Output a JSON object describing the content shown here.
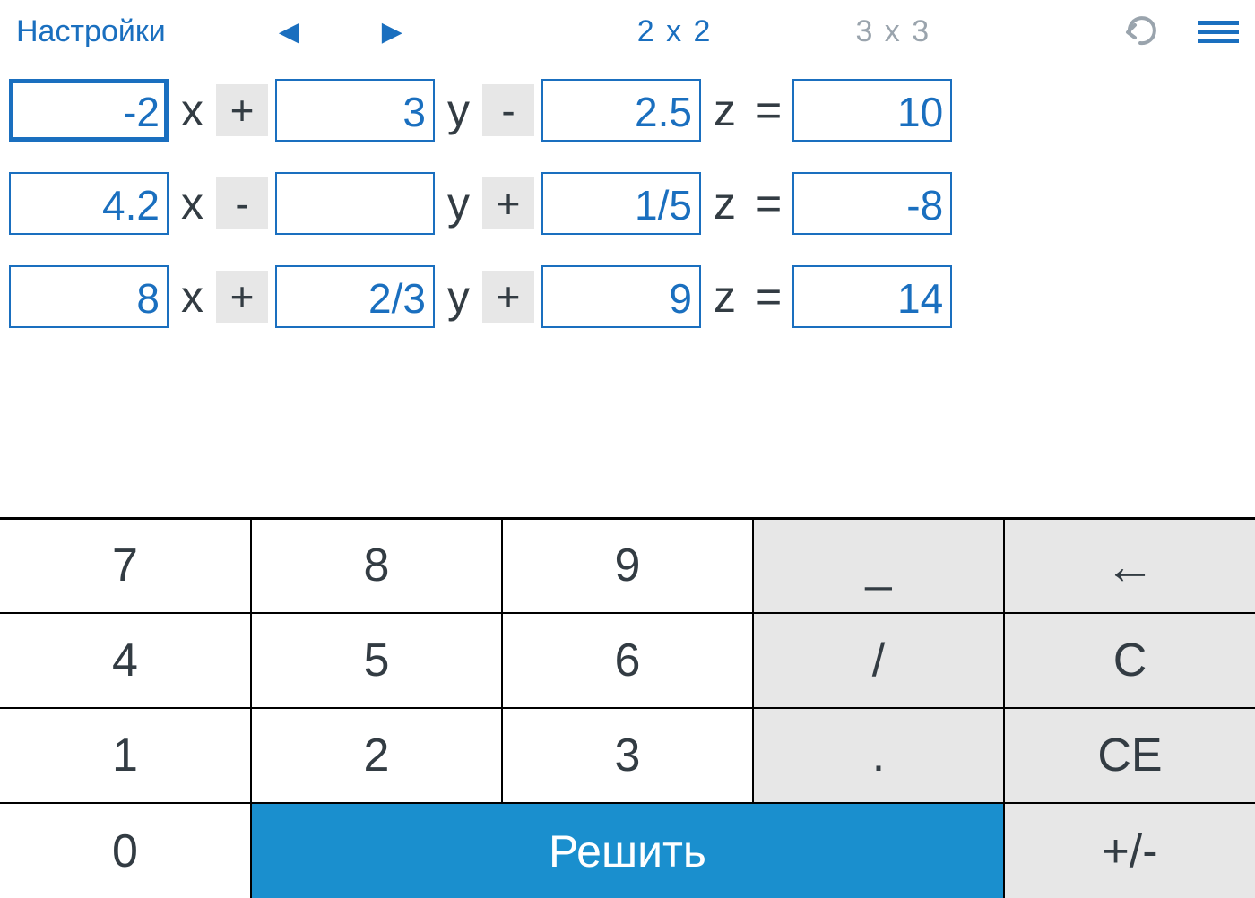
{
  "topbar": {
    "settings": "Настройки",
    "size_active": "2 x 2",
    "size_inactive": "3 x 3"
  },
  "vars": {
    "x": "x",
    "y": "y",
    "z": "z",
    "eq": "="
  },
  "rows": [
    {
      "a": "-2",
      "op1": "+",
      "b": "3",
      "op2": "-",
      "c": "2.5",
      "r": "10"
    },
    {
      "a": "4.2",
      "op1": "-",
      "b": "",
      "op2": "+",
      "c": "1/5",
      "r": "-8"
    },
    {
      "a": "8",
      "op1": "+",
      "b": "2/3",
      "op2": "+",
      "c": "9",
      "r": "14"
    }
  ],
  "keypad": {
    "k7": "7",
    "k8": "8",
    "k9": "9",
    "under": "_",
    "back": "←",
    "k4": "4",
    "k5": "5",
    "k6": "6",
    "slash": "/",
    "clear": "C",
    "k1": "1",
    "k2": "2",
    "k3": "3",
    "dot": ".",
    "ce": "CE",
    "k0": "0",
    "solve": "Решить",
    "pm": "+/-"
  }
}
